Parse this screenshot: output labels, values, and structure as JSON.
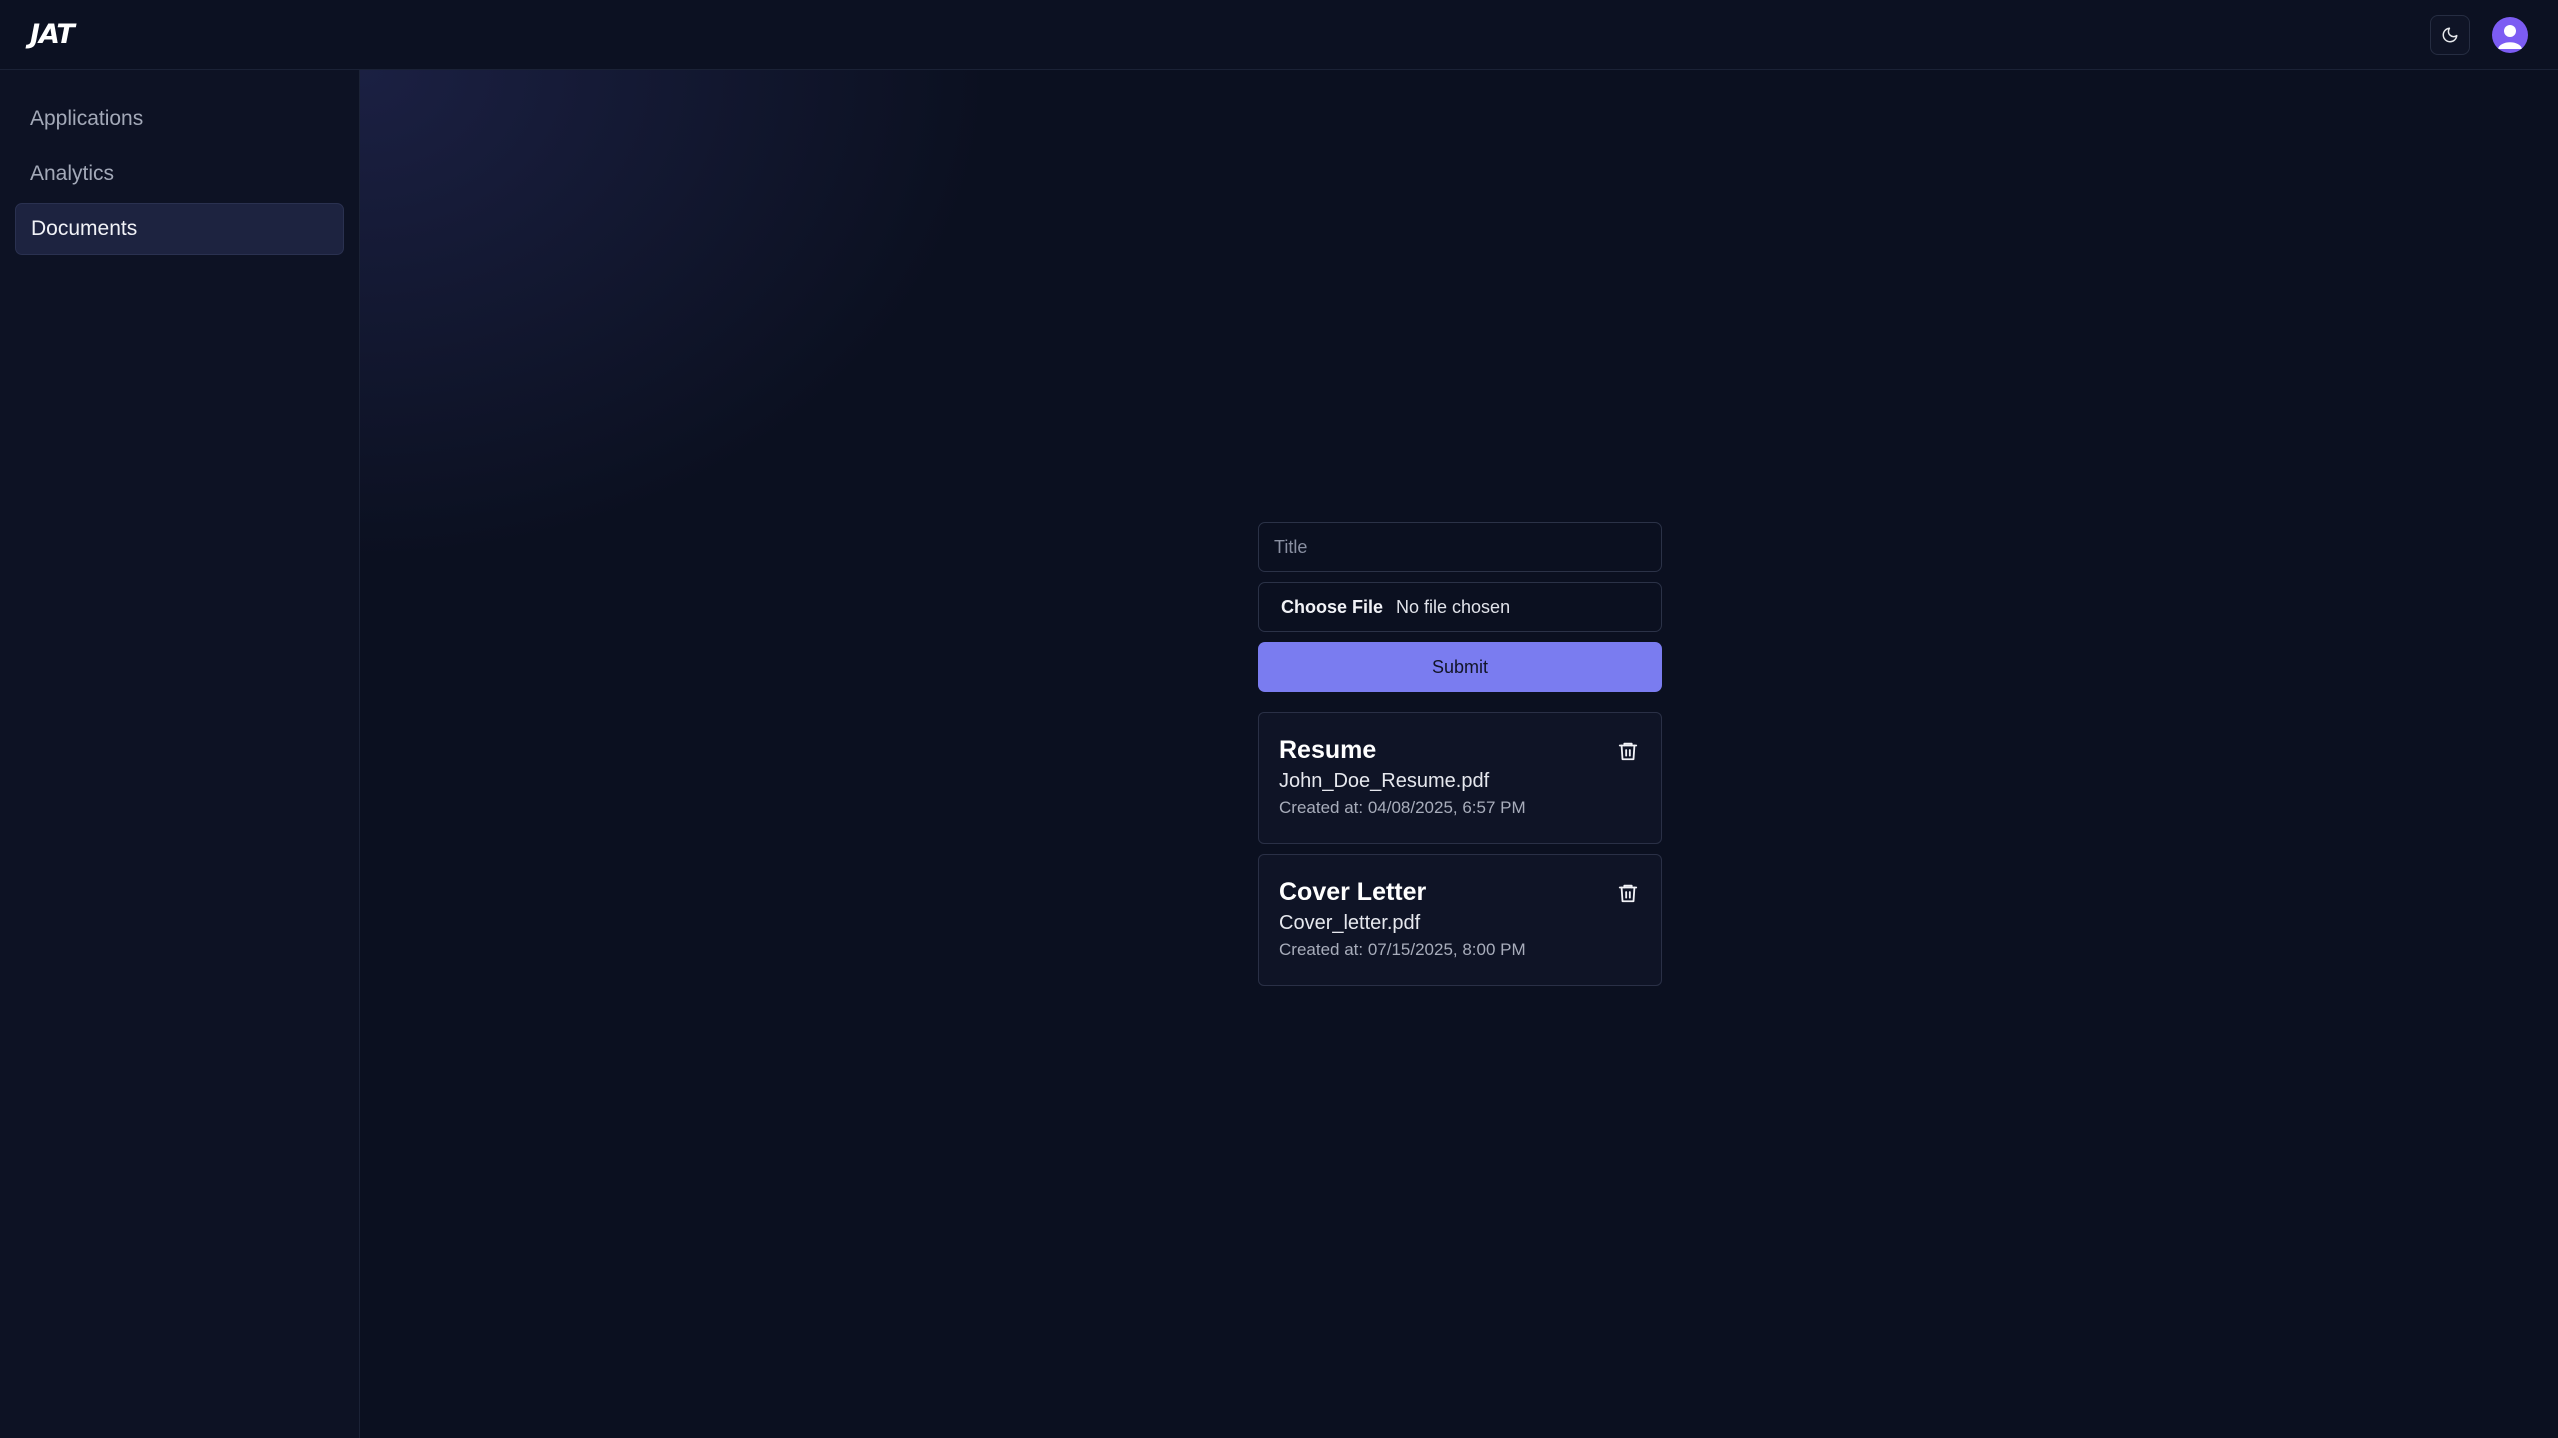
{
  "header": {
    "logo": "JAT",
    "theme_icon": "moon-icon",
    "avatar_icon": "user-icon"
  },
  "sidebar": {
    "items": [
      {
        "label": "Applications",
        "active": false
      },
      {
        "label": "Analytics",
        "active": false
      },
      {
        "label": "Documents",
        "active": true
      }
    ]
  },
  "form": {
    "title_placeholder": "Title",
    "title_value": "",
    "choose_file_label": "Choose File",
    "no_file_label": "No file chosen",
    "submit_label": "Submit"
  },
  "documents": [
    {
      "title": "Resume",
      "filename": "John_Doe_Resume.pdf",
      "created": "Created at: 04/08/2025, 6:57 PM",
      "delete_icon": "trash-icon"
    },
    {
      "title": "Cover Letter",
      "filename": "Cover_letter.pdf",
      "created": "Created at: 07/15/2025, 8:00 PM",
      "delete_icon": "trash-icon"
    }
  ],
  "colors": {
    "background": "#0b1020",
    "accent": "#7a7cf0",
    "avatar": "#7c5cf3",
    "active_nav": "#1d2340"
  }
}
